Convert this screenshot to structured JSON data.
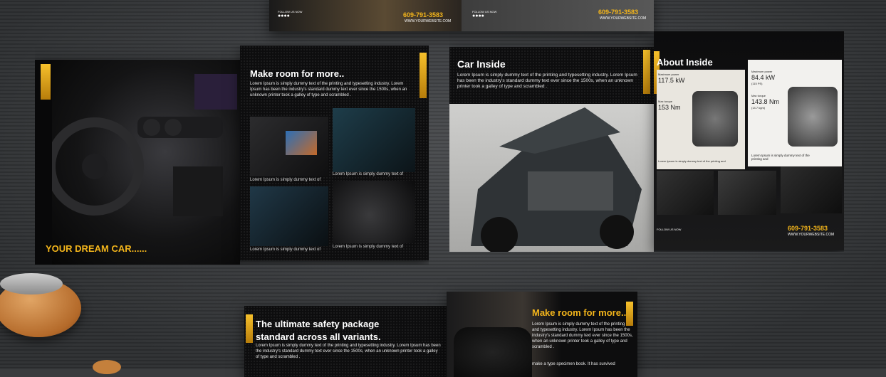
{
  "top_brochure": {
    "follow_label_left": "FOLLOW US NOW",
    "phone_left": "609-791-3583",
    "website_left": "WWW.YOURWEBSITE.COM",
    "follow_label_right": "FOLLOW US NOW",
    "phone_right": "609-791-3583",
    "website_right": "WWW.YOURWEBSITE.COM"
  },
  "left_brochure": {
    "cover_tagline": "YOUR DREAM CAR......",
    "heading": "Make room for more..",
    "body": "Lorem Ipsum is simply dummy text of the printing and typesetting industry. Lorem Ipsum has been the industry's standard dummy text ever since the 1500s, when an unknown printer took a galley of type and scrambled .",
    "captions": [
      "Lorem Ipsum is simply dummy text of",
      "Lorem Ipsum is simply dummy text of",
      "Lorem Ipsum is simply dummy text of",
      "Lorem Ipsum is simply dummy text of"
    ]
  },
  "right_brochure": {
    "heading": "Car Inside",
    "body": "Lorem Ipsum is simply dummy text of the printing and typesetting industry. Lorem Ipsum has been the industry's standard dummy text ever since the 1500s, when an unknown printer took a galley of type and scrambled .",
    "about_heading": "About Inside",
    "spec1_label": "Maximum power",
    "spec1_value": "117.5 kW",
    "spec2_label": "Max torque",
    "spec2_value": "153 Nm",
    "spec3_label": "Maximum power",
    "spec3_value": "84.4 kW",
    "spec3_unit": "(115 PS)",
    "spec4_label": "Max torque",
    "spec4_value": "143.8 Nm",
    "spec4_unit": "(14.7 kgm)",
    "engine_caption_left": "Lorem Ipsum is simply dummy text of the printing and",
    "engine_caption_right": "Lorem Ipsum is simply dummy text of the printing and",
    "follow_label": "FOLLOW US NOW",
    "phone": "609-791-3583",
    "website": "WWW.YOURWEBSITE.COM"
  },
  "bottom_brochure": {
    "heading_line1": "The ultimate safety package",
    "heading_line2": "standard across all variants.",
    "body": "Lorem Ipsum is simply dummy text of the printing and typesetting industry. Lorem Ipsum has been the industry's standard dummy text ever since the 1500s, when an unknown printer took a galley of type and scrambled .",
    "right_heading": "Make room for more..",
    "right_body": "Lorem Ipsum is simply dummy text of the printing and typesetting industry. Lorem Ipsum has been the industry's standard dummy text ever since the 1500s, when an unknown printer took a galley of type and scrambled .",
    "right_body2": "make a type specimen book. It has survived"
  },
  "colors": {
    "accent": "#f3b51b",
    "panel": "#0b0b0c",
    "surface": "#3a3c3e"
  }
}
